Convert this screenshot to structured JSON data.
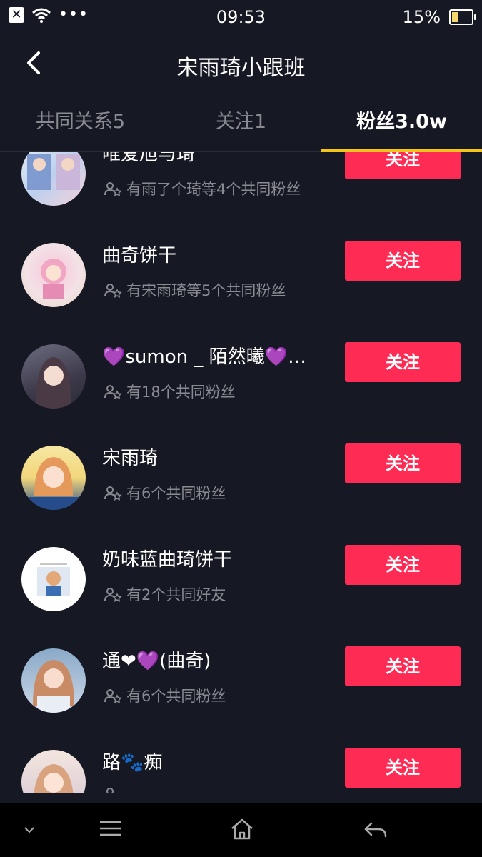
{
  "status": {
    "time": "09:53",
    "battery": "15%",
    "battery_level": 0.15,
    "dots": "•••"
  },
  "header": {
    "title": "宋雨琦小跟班"
  },
  "tabs": [
    {
      "label": "共同关系5"
    },
    {
      "label": "关注1"
    },
    {
      "label": "粉丝3.0w",
      "active": true
    }
  ],
  "users": [
    {
      "name": "唯爱旭与琦",
      "mutual": "有雨了个琦等4个共同粉丝",
      "button": "关注"
    },
    {
      "name": "曲奇饼干",
      "mutual": "有宋雨琦等5个共同粉丝",
      "button": "关注"
    },
    {
      "name": "💜sumon _ 陌然曦💜…",
      "mutual": "有18个共同粉丝",
      "button": "关注"
    },
    {
      "name": "宋雨琦",
      "mutual": "有6个共同粉丝",
      "button": "关注"
    },
    {
      "name": "奶味蓝曲琦饼干",
      "mutual": "有2个共同好友",
      "button": "关注"
    },
    {
      "name": "通❤💜(曲奇)",
      "mutual": "有6个共同粉丝",
      "button": "关注"
    },
    {
      "name": "路🐾痴",
      "mutual": "",
      "button": "关注"
    }
  ],
  "colors": {
    "background": "#161823",
    "accent": "#fe2c55",
    "tab_indicator": "#f5c518",
    "muted": "#8a8b91"
  }
}
